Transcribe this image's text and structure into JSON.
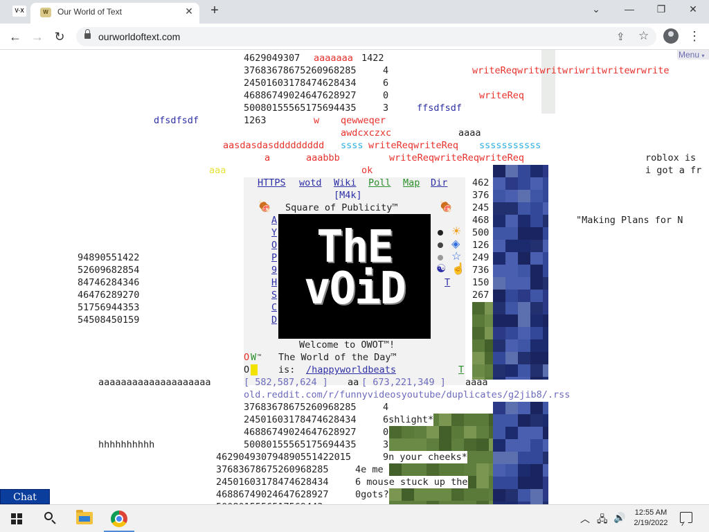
{
  "browser": {
    "tab_title": "Our World of Text",
    "tab_close": "✕",
    "new_tab": "+",
    "url": "ourworldoftext.com",
    "window": {
      "minimize": "⌄",
      "min2": "—",
      "restore": "❐",
      "close": "✕"
    },
    "icons": [
      "owot-icon",
      "back-arrow-icon",
      "forward-arrow-icon",
      "reload-icon",
      "lock-icon",
      "share-icon",
      "star-icon",
      "profile-icon",
      "kebab-menu-icon"
    ]
  },
  "page": {
    "menu": "Menu",
    "lines": {
      "n1": "4629049307",
      "a1": "aaaaaaa",
      "n1b": "1422",
      "n2": "37683678675260968285",
      "n2b": "4",
      "n3": "24501603178474628434",
      "n3b": "6",
      "n4": "46886749024647628927",
      "n4b": "0",
      "n5": "50080155565175694435",
      "n5b": "3",
      "n6": "1263",
      "w": "w",
      "qew": "qewweqer",
      "awd": "awdcxczxc",
      "aaaa": "aaaa",
      "dfs": "dfsdfsdf",
      "ffs": "ffsdfsdf",
      "wrq1": "writeReqwritwritwriwritwritewrwrite",
      "wrq2": "writeReq",
      "asd": "aasdasdasddddddddd",
      "ssss1": "ssss",
      "wrq3": "writeReqwriteReq",
      "ssss2": "sssssssssss",
      "a": "a",
      "aaabbb": "aaabbb",
      "wrq4": "writeReqwriteReqwriteReq",
      "aaa_y": "aaa",
      "ok": "ok",
      "roblox": "roblox is",
      "gotafr": "i got a fr",
      "plans": "\"Making Plans for N",
      "left_nums": [
        "94890551422",
        "52609682854",
        "84746284346",
        "46476289270",
        "51756944353",
        "54508450159"
      ],
      "right_nums": [
        "462",
        "376",
        "245",
        "468",
        "500",
        "126",
        "249",
        "736",
        "150",
        "267"
      ],
      "long_a": "aaaaaaaaaaaaaaaaaaaa",
      "coord1": "[ 582,587,624 ]",
      "aa": "aa",
      "coord2": "[ 673,221,349 ]",
      "aaaa2": "aaaa",
      "reddit": "old.reddit.com/r/funnyvideosyoutube/duplicates/g2jib8/.rss",
      "b1": "37683678675260968285",
      "b1b": "4",
      "b2": "24501603178474628434",
      "b2b": "6shlight*",
      "b3": "46886749024647628927",
      "b3b": "0",
      "hh": "hhhhhhhhhh",
      "b4": "50080155565175694435",
      "b4b": "3",
      "b5": "462904930794890551422015",
      "b5b": "9n your cheeks*",
      "b6": "37683678675260968285",
      "b6b": "4e me",
      "b7": "24501603178474628434",
      "b7b": "6 mouse stuck up the",
      "b8": "46886749024647628927",
      "b8b": "0gots?",
      "b9": "5008015556517569443"
    },
    "square": {
      "links": [
        "HTTPS",
        "wotd",
        "Wiki",
        "Poll",
        "Map",
        "Dir"
      ],
      "m4k": "[M4k]",
      "title": "Square of Publicity™",
      "side_letters": [
        "A",
        "Y",
        "O",
        "P",
        "9",
        "H",
        "S",
        "C",
        "D"
      ],
      "void_line1": "ThE",
      "void_line2": "vOiD",
      "welcome": "Welcome to OWOT™!",
      "wotd_label": "The World of the Day™",
      "is": "is:",
      "wotd_link": "/happyworldbeats",
      "ow_o": "O",
      "ow_w": "W",
      "tm": "™",
      "o2": "O",
      "t_right": "T",
      "t_right2": "T",
      "glyph_icons": [
        "meat-icon",
        "meat-icon",
        "sun-icon",
        "diamond-icon",
        "star-outline-icon",
        "yin-yang-icon",
        "pointing-hand-icon"
      ]
    },
    "chat": "Chat",
    "colors": {
      "red": "#e8312c",
      "blue": "#2d2fa6",
      "cyan": "#2eaee6",
      "yellow": "#e7e23a",
      "link": "#2d2fa6",
      "chat_bg": "#0b3e9c"
    }
  },
  "taskbar": {
    "time": "12:55 AM",
    "date": "2/19/2022",
    "icons": [
      "windows-start-icon",
      "search-icon",
      "file-explorer-icon",
      "chrome-icon",
      "chevron-up-icon",
      "network-icon",
      "volume-icon",
      "notification-icon"
    ]
  }
}
